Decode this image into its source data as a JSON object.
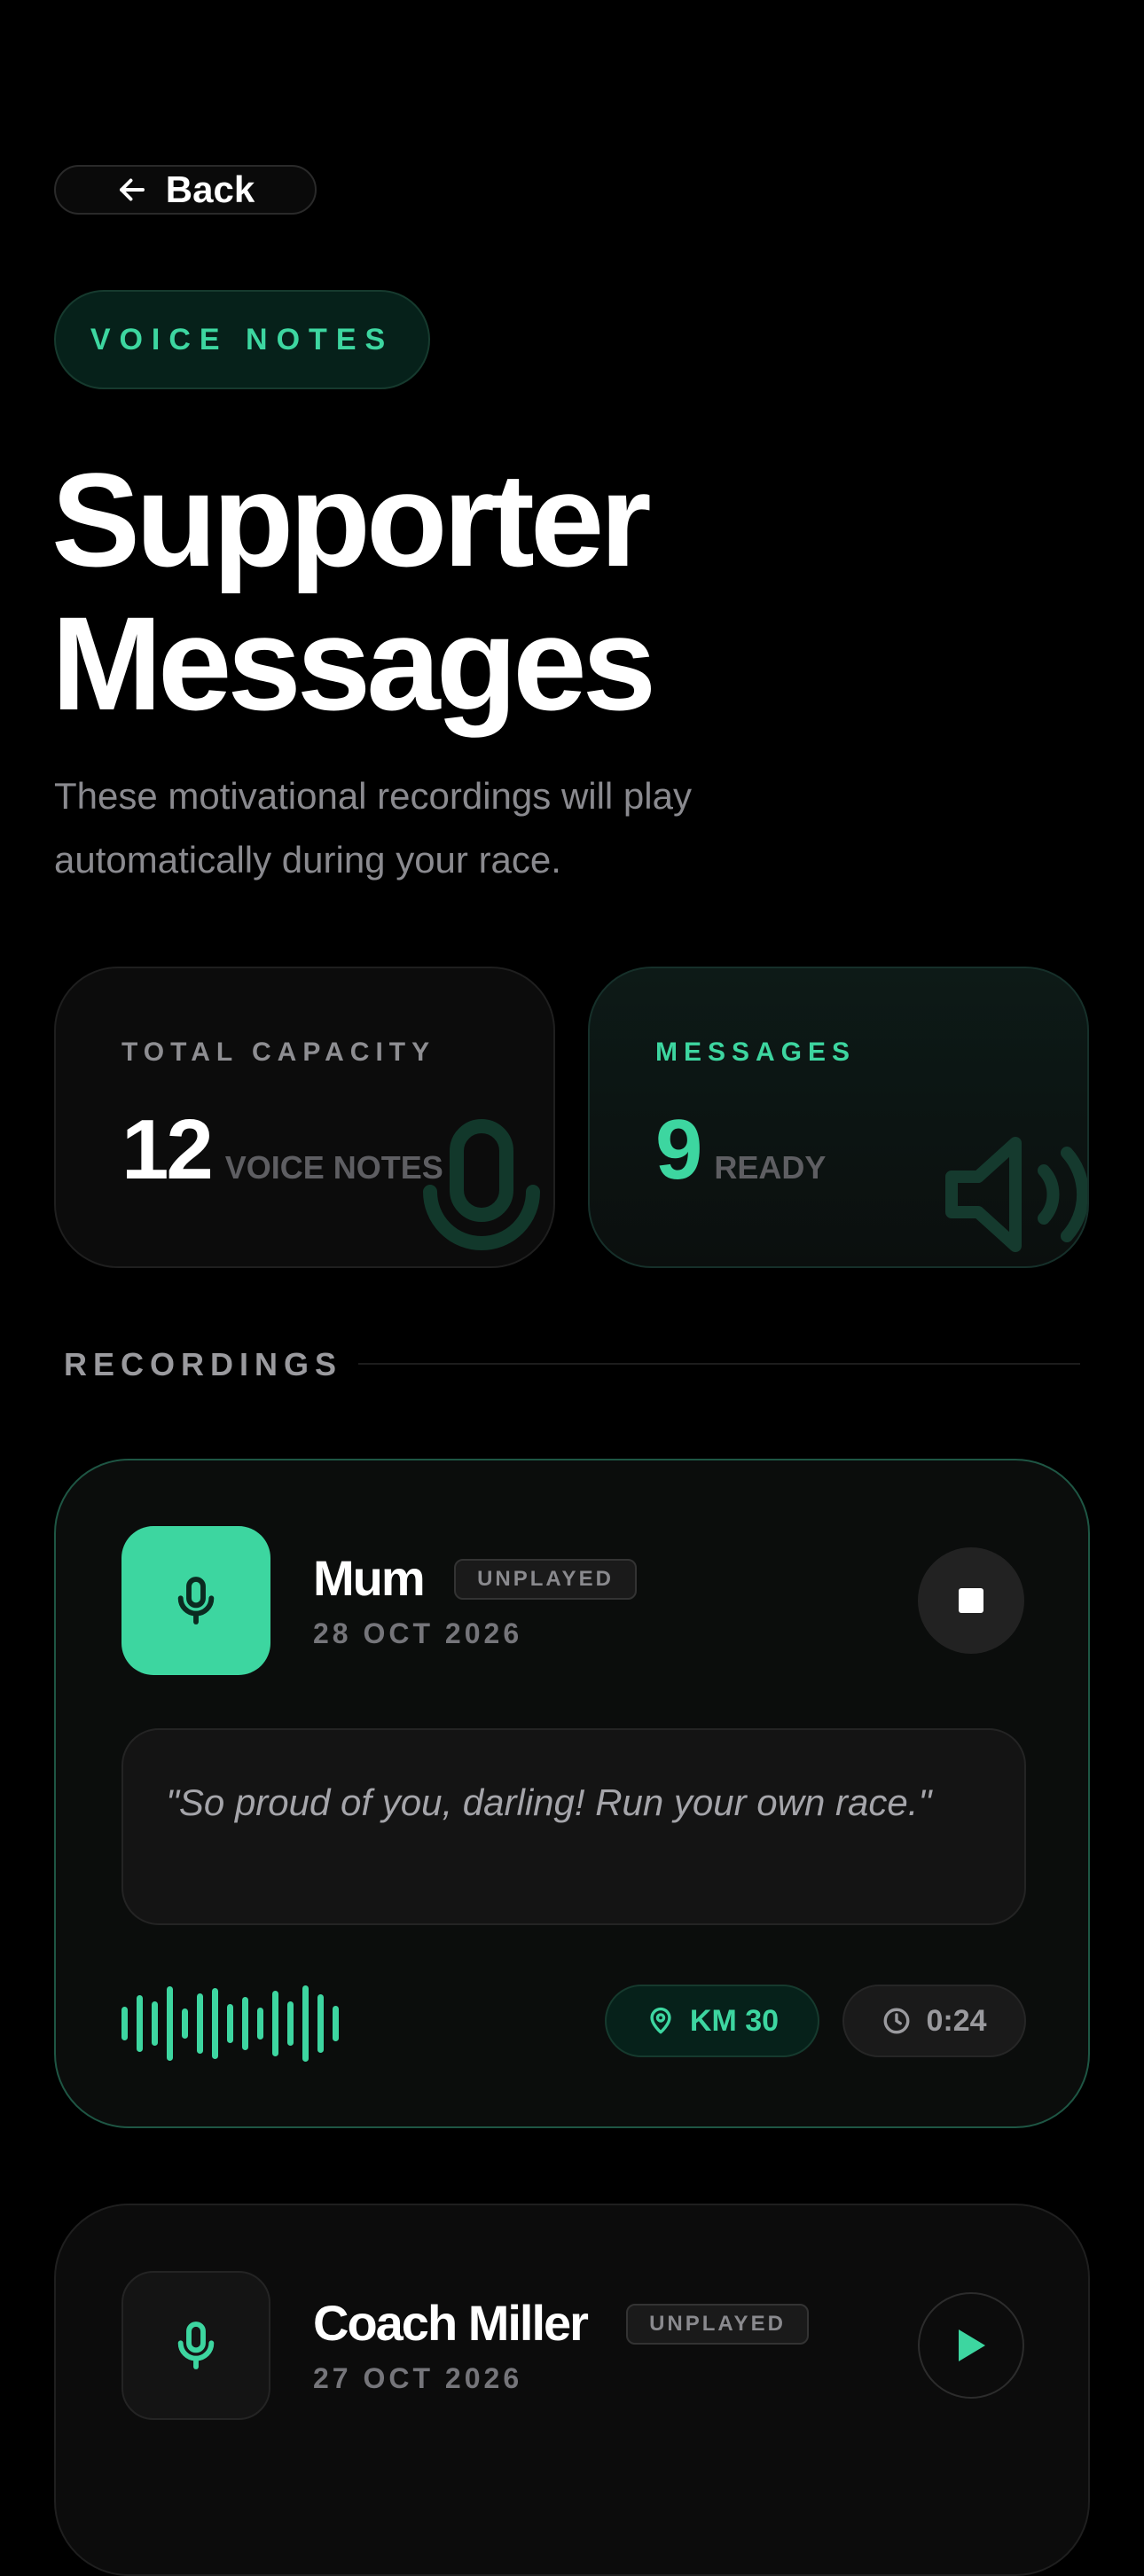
{
  "nav": {
    "back_label": "Back"
  },
  "section_pill": "VOICE NOTES",
  "title": {
    "line1": "Supporter",
    "line2": "Messages"
  },
  "subtitle": "These motivational recordings will play automatically during your race.",
  "stats": [
    {
      "label": "TOTAL CAPACITY",
      "value": "12",
      "unit": "VOICE NOTES",
      "icon": "mic-icon"
    },
    {
      "label": "MESSAGES",
      "value": "9",
      "unit": "READY",
      "icon": "speaker-icon"
    }
  ],
  "recordings_header": "RECORDINGS",
  "recordings": [
    {
      "name": "Mum",
      "badge": "UNPLAYED",
      "date": "28 OCT 2026",
      "quote": "\"So proud of you, darling! Run your own race.\"",
      "km": "KM 30",
      "duration": "0:24",
      "state": "playing",
      "control_icon": "stop-icon"
    },
    {
      "name": "Coach Miller",
      "badge": "UNPLAYED",
      "date": "27 OCT 2026",
      "state": "idle",
      "control_icon": "play-icon"
    }
  ],
  "colors": {
    "accent": "#3dd6a0",
    "background": "#000000",
    "card": "#0c0c0c",
    "muted_text": "#8a8a8f"
  }
}
